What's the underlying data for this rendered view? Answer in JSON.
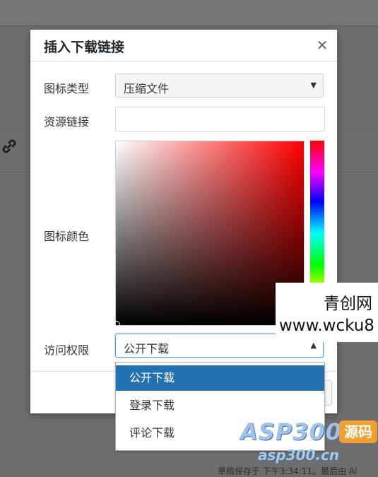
{
  "dialog": {
    "title": "插入下载链接",
    "close_icon": "close-icon",
    "icon_type": {
      "label": "图标类型",
      "value": "压缩文件"
    },
    "resource_link": {
      "label": "资源链接",
      "value": ""
    },
    "icon_color": {
      "label": "图标颜色",
      "hue_color": "#ff0000"
    },
    "access": {
      "label": "访问权限",
      "value": "公开下载",
      "options": [
        "公开下载",
        "登录下载",
        "评论下载"
      ],
      "selected_index": 0,
      "accent": "#2271b1"
    }
  },
  "background": {
    "link_icon": "link-icon",
    "footer_text": "草稿保存于 下午3:34:11。最后由 Al"
  },
  "watermarks": {
    "site_name": "青创网",
    "site_url": "www.wcku8",
    "brand_main": "ASP300",
    "brand_tag": "源码",
    "brand_url": "asp300.cn"
  }
}
